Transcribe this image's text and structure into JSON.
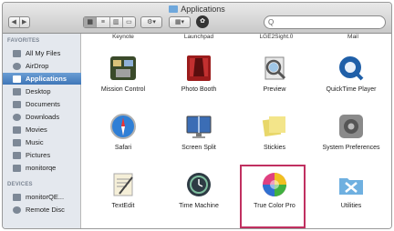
{
  "window": {
    "title": "Applications"
  },
  "toolbar": {
    "back": "◀",
    "forward": "▶",
    "views": [
      "▦",
      "≡",
      "▥",
      "▭"
    ],
    "action": "⚙▾",
    "arrange": "▦▾",
    "share": "✿",
    "search_placeholder": "Q"
  },
  "sidebar": {
    "favorites_heading": "FAVORITES",
    "favorites": [
      {
        "label": "All My Files",
        "icon": "all-files-icon"
      },
      {
        "label": "AirDrop",
        "icon": "airdrop-icon"
      },
      {
        "label": "Applications",
        "icon": "applications-icon",
        "selected": true
      },
      {
        "label": "Desktop",
        "icon": "desktop-icon"
      },
      {
        "label": "Documents",
        "icon": "documents-icon"
      },
      {
        "label": "Downloads",
        "icon": "downloads-icon"
      },
      {
        "label": "Movies",
        "icon": "movies-icon"
      },
      {
        "label": "Music",
        "icon": "music-icon"
      },
      {
        "label": "Pictures",
        "icon": "pictures-icon"
      },
      {
        "label": "monitorqe",
        "icon": "home-icon"
      }
    ],
    "devices_heading": "DEVICES",
    "devices": [
      {
        "label": "monitorQE...",
        "icon": "disk-icon"
      },
      {
        "label": "Remote Disc",
        "icon": "remote-disc-icon"
      }
    ]
  },
  "partial_row": [
    "Keynote",
    "Launchpad",
    "LGE2Sight.0",
    "Mail"
  ],
  "apps": [
    {
      "label": "Mission Control",
      "icon": "mission-control-icon",
      "color": "#3a4a2a"
    },
    {
      "label": "Photo Booth",
      "icon": "photo-booth-icon",
      "color": "#9b1c1c"
    },
    {
      "label": "Preview",
      "icon": "preview-icon",
      "color": "#7a8a9a"
    },
    {
      "label": "QuickTime Player",
      "icon": "quicktime-icon",
      "color": "#1f5fa8"
    },
    {
      "label": "Safari",
      "icon": "safari-icon",
      "color": "#2f7fd6"
    },
    {
      "label": "Screen Split",
      "icon": "screen-split-icon",
      "color": "#3b6db5"
    },
    {
      "label": "Stickies",
      "icon": "stickies-icon",
      "color": "#e8d76a"
    },
    {
      "label": "System Preferences",
      "icon": "system-preferences-icon",
      "color": "#8a8a8a"
    },
    {
      "label": "TextEdit",
      "icon": "textedit-icon",
      "color": "#d9cfb0"
    },
    {
      "label": "Time Machine",
      "icon": "time-machine-icon",
      "color": "#2e3b44"
    },
    {
      "label": "True Color Pro",
      "icon": "true-color-pro-icon",
      "color": "#e04080"
    },
    {
      "label": "Utilities",
      "icon": "utilities-icon",
      "color": "#6fb0e0"
    }
  ],
  "highlight_color": "#c03060"
}
